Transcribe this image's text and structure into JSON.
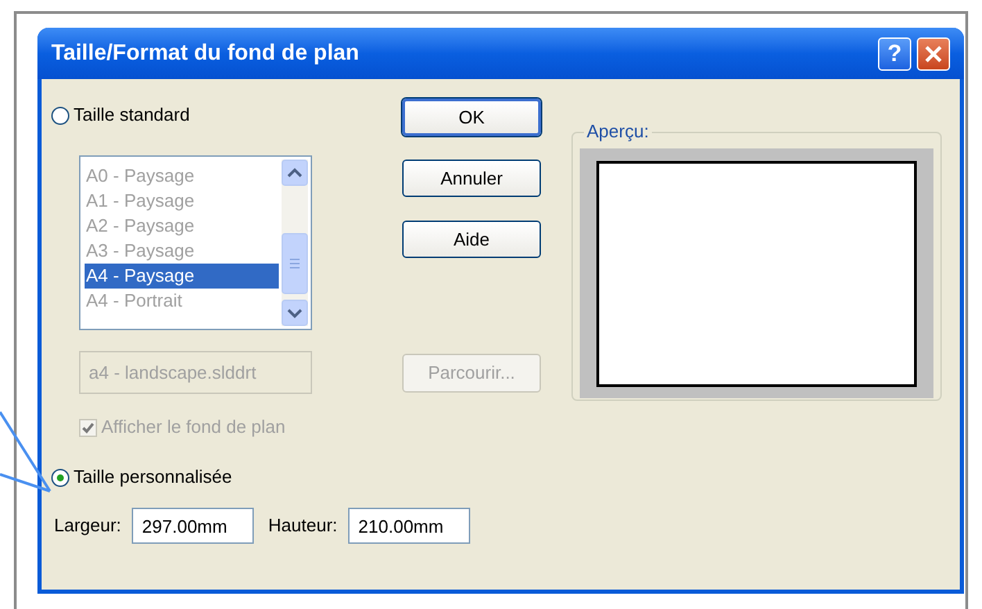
{
  "window": {
    "title": "Taille/Format du fond de plan",
    "help": "?"
  },
  "standard_size": {
    "label": "Taille standard",
    "selected": false
  },
  "sheet_list": {
    "disabled": true,
    "items": [
      {
        "label": "A0 - Paysage",
        "selected": false
      },
      {
        "label": "A1 - Paysage",
        "selected": false
      },
      {
        "label": "A2 - Paysage",
        "selected": false
      },
      {
        "label": "A3 - Paysage",
        "selected": false
      },
      {
        "label": "A4 - Paysage",
        "selected": true
      },
      {
        "label": "A4 - Portrait",
        "selected": false
      }
    ]
  },
  "template_field": {
    "value": "a4 - landscape.slddrt",
    "disabled": true
  },
  "show_background": {
    "label": "Afficher le fond de plan",
    "checked": true,
    "disabled": true
  },
  "custom_size": {
    "label": "Taille personnalisée",
    "selected": true
  },
  "width_field": {
    "label": "Largeur:",
    "value": "297.00mm"
  },
  "height_field": {
    "label": "Hauteur:",
    "value": "210.00mm"
  },
  "buttons": [
    {
      "label": "OK",
      "default": true,
      "disabled": false
    },
    {
      "label": "Annuler",
      "default": false,
      "disabled": false
    },
    {
      "label": "Aide",
      "default": false,
      "disabled": false
    }
  ],
  "browse_button": {
    "label": "Parcourir...",
    "disabled": true
  },
  "preview": {
    "label": "Aperçu:"
  }
}
